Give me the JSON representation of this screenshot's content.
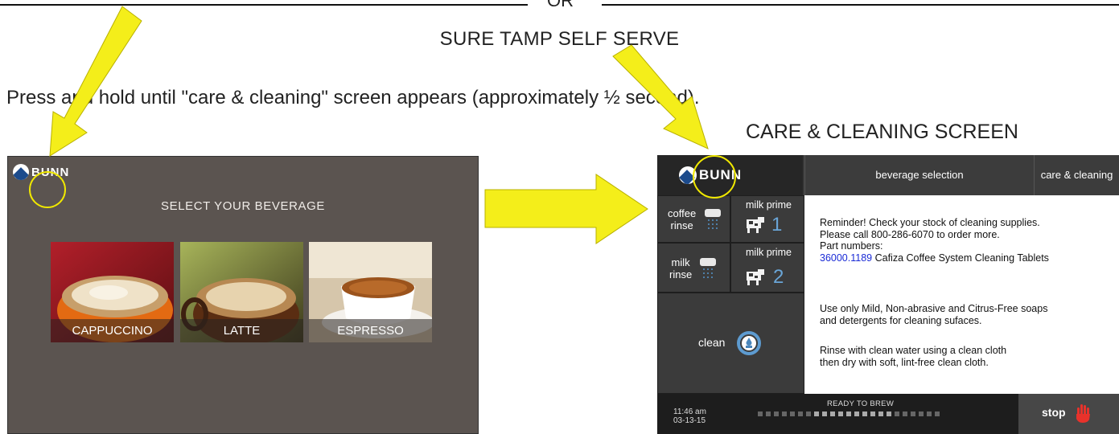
{
  "doc": {
    "or": "OR",
    "sure_tamp": "SURE TAMP SELF SERVE",
    "instruction": "Press and hold until \"care & cleaning\" screen appears (approximately ½ second).",
    "care_title": "CARE & CLEANING SCREEN"
  },
  "left_screen": {
    "logo": "BUNN",
    "title": "SELECT YOUR BEVERAGE",
    "beverages": [
      "CAPPUCCINO",
      "LATTE",
      "ESPRESSO"
    ]
  },
  "right_screen": {
    "logo": "BUNN",
    "tabs": {
      "beverage_selection": "beverage selection",
      "care_cleaning": "care & cleaning"
    },
    "buttons": {
      "coffee_rinse_1": "coffee",
      "coffee_rinse_2": "rinse",
      "milk_rinse_1": "milk",
      "milk_rinse_2": "rinse",
      "milk_prime_1_label": "milk prime",
      "milk_prime_1_num": "1",
      "milk_prime_2_label": "milk prime",
      "milk_prime_2_num": "2",
      "clean": "clean"
    },
    "content": {
      "line1": "Reminder! Check your stock of cleaning supplies.",
      "line2": "Please call 800-286-6070 to order more.",
      "line3": "Part numbers:",
      "part_number": "36000.1189",
      "part_desc": " Cafiza Coffee System Cleaning Tablets",
      "soap1": "Use only Mild, Non-abrasive and Citrus-Free soaps",
      "soap2": "and detergents for cleaning sufaces.",
      "rinse1": "Rinse with clean water using a clean cloth",
      "rinse2": "then dry with soft, lint-free clean cloth."
    },
    "status": {
      "time": "11:46 am",
      "date": "03-13-15",
      "ready": "READY TO BREW",
      "stop": "stop"
    },
    "colors": {
      "part_number": "#1a2bd6",
      "arrow": "#f4ee1a",
      "stop_hand": "#e8322b"
    }
  }
}
